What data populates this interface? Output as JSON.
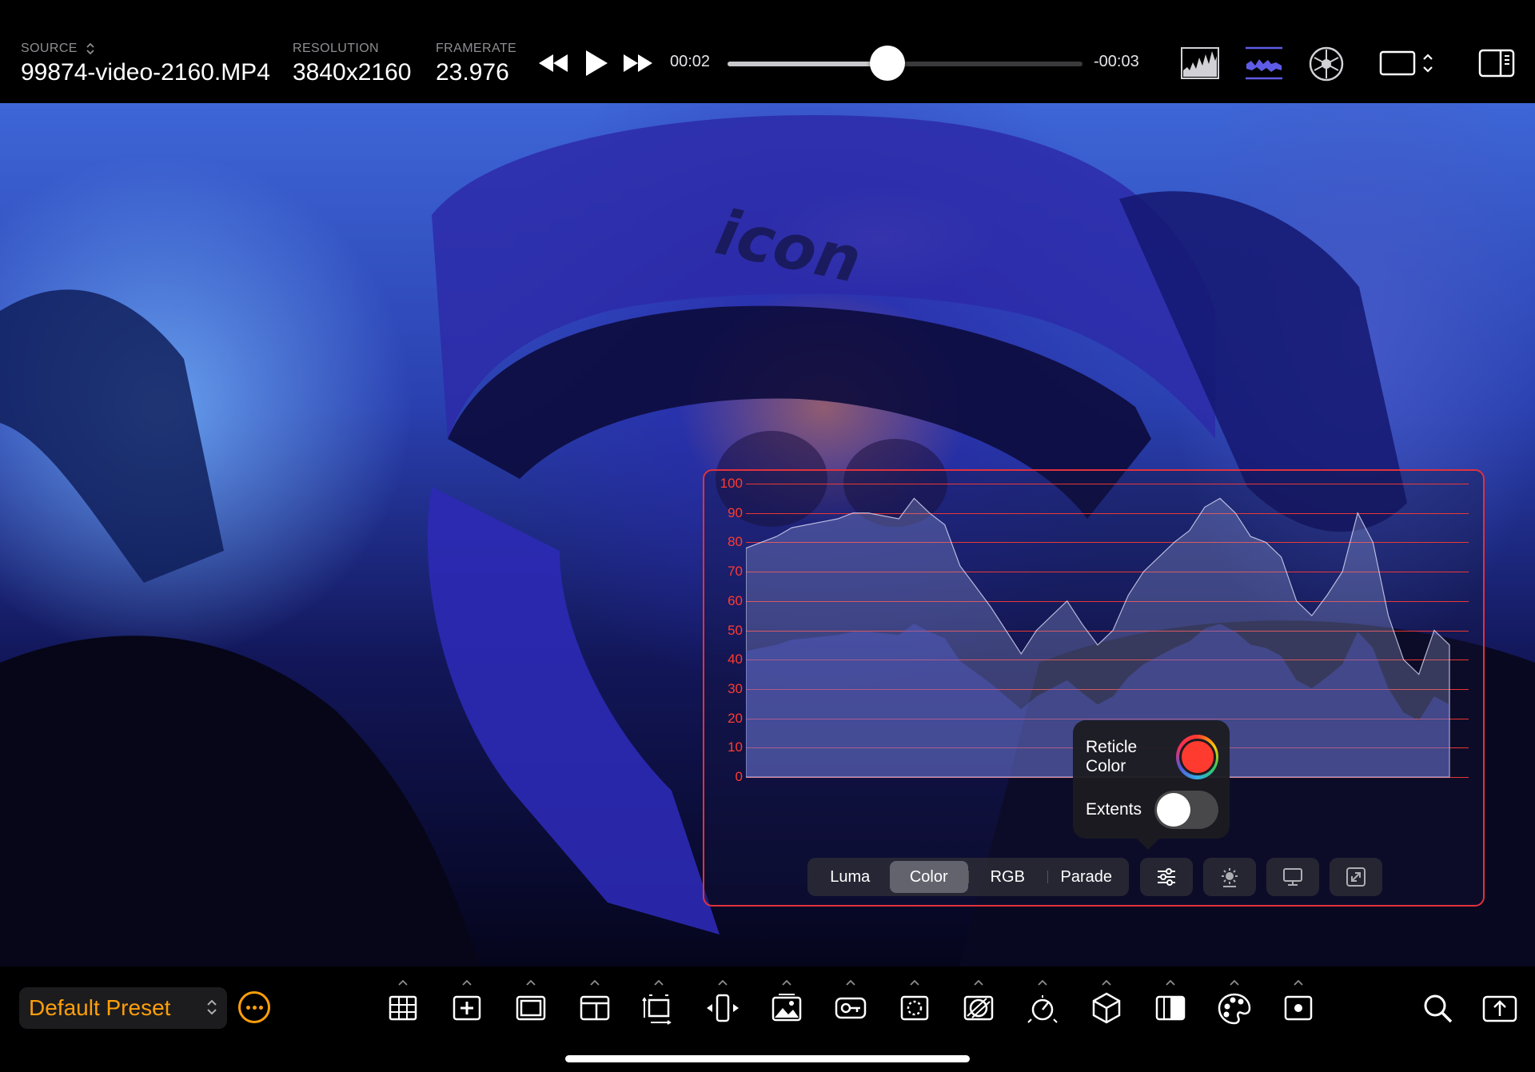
{
  "topbar": {
    "source_label": "SOURCE",
    "source_value": "99874-video-2160.MP4",
    "resolution_label": "RESOLUTION",
    "resolution_value": "3840x2160",
    "framerate_label": "FRAMERATE",
    "framerate_value": "23.976",
    "elapsed": "00:02",
    "remaining": "-00:03",
    "playback_position": 0.45,
    "icons": [
      "rewind-icon",
      "play-icon",
      "fast-forward-icon",
      "histogram-icon",
      "waveform-icon",
      "vectorscope-icon",
      "aspect-frame-icon",
      "sidebar-icon"
    ]
  },
  "viewer": {
    "helmet_brand_text": "icon"
  },
  "scope": {
    "scale_labels": [
      "100",
      "90",
      "80",
      "70",
      "60",
      "50",
      "40",
      "30",
      "20",
      "10",
      "0"
    ],
    "reticle_color": "#ff3b30",
    "modes": [
      "Luma",
      "Color",
      "RGB",
      "Parade"
    ],
    "active_mode": "Color",
    "buttons": [
      "settings-sliders-icon",
      "brightness-icon",
      "display-icon",
      "expand-icon"
    ]
  },
  "popover": {
    "reticle_label": "Reticle Color",
    "extents_label": "Extents",
    "extents_on": false
  },
  "bottombar": {
    "preset_label": "Default Preset",
    "accent_color": "#ff9f0a",
    "tools": [
      "grid-overlay-icon",
      "crosshair-icon",
      "frame-guide-icon",
      "layout-icon",
      "transform-icon",
      "anamorphic-icon",
      "image-overlay-icon",
      "false-color-icon",
      "focus-peaking-icon",
      "zebra-icon",
      "exposure-icon",
      "lut-cube-icon",
      "gradient-icon",
      "color-palette-icon",
      "spot-meter-icon"
    ],
    "right_icons": [
      "search-icon",
      "export-icon"
    ]
  }
}
